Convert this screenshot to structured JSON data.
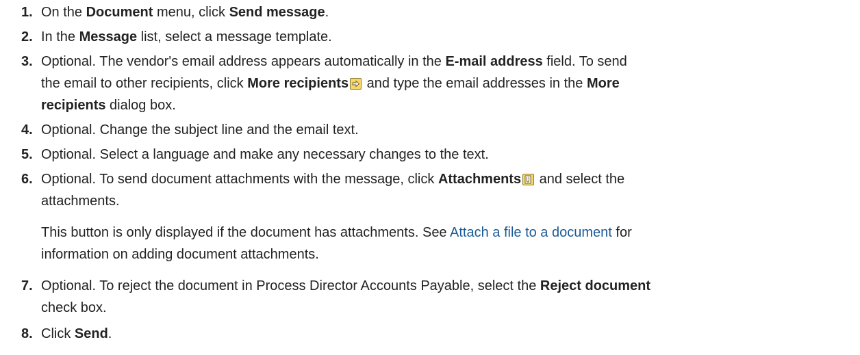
{
  "steps": [
    {
      "num": "1.",
      "t1": "On the ",
      "b1": "Document",
      "t2": " menu, click ",
      "b2": "Send message",
      "t3": "."
    },
    {
      "num": "2.",
      "t1": "In the ",
      "b1": "Message",
      "t2": " list, select a message template."
    },
    {
      "num": "3.",
      "line1": "Optional. The vendor's email address appears automatically in the ",
      "b1": "E-mail address",
      "t2": " field. To send",
      "line2a": "the email to other recipients, click ",
      "b2": "More recipients",
      "line2b": " and type the email addresses in the ",
      "b3": "More",
      "b4": "recipients",
      "line3": " dialog box.",
      "icon": "more-recipients-arrow-icon"
    },
    {
      "num": "4.",
      "t1": "Optional. Change the subject line and the email text."
    },
    {
      "num": "5.",
      "t1": "Optional. Select a language and make any necessary changes to the text."
    },
    {
      "num": "6.",
      "t1": "Optional. To send document attachments with the message, click ",
      "b1": "Attachments",
      "t2": " and select the",
      "line2": "attachments.",
      "icon": "attachments-clip-icon",
      "note_line1a": "This button is only displayed if the document has attachments. See ",
      "note_link": "Attach a file to a document",
      "note_line1b": " for",
      "note_line2": "information on adding document attachments."
    },
    {
      "num": "7.",
      "t1": "Optional. To reject the document in Process Director Accounts Payable, select the ",
      "b1": "Reject document",
      "line2": "check box."
    },
    {
      "num": "8.",
      "t1": "Click ",
      "b1": "Send",
      "t2": "."
    }
  ],
  "colors": {
    "text": "#222222",
    "link": "#1a5a96",
    "icon_fill": "#f5d76e",
    "icon_border": "#8a7a3a"
  }
}
